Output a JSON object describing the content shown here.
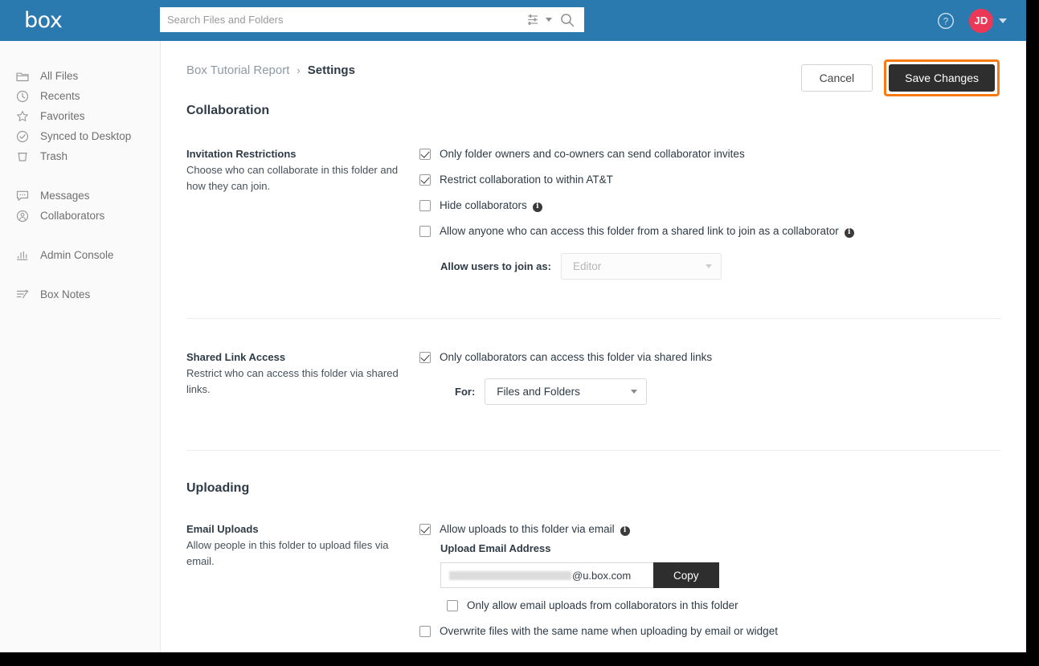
{
  "topbar": {
    "logo_text": "box",
    "search": {
      "placeholder": "Search Files and Folders",
      "value": "",
      "filter_icon": "filters-icon",
      "search_icon": "search-icon"
    },
    "help_icon": "help-circle-icon",
    "avatar_initials": "JD",
    "brand_color": "#2a7ab0",
    "avatar_color": "#ed3757"
  },
  "sidebar": {
    "items": [
      {
        "label": "All Files",
        "icon": "folder-icon"
      },
      {
        "label": "Recents",
        "icon": "clock-icon"
      },
      {
        "label": "Favorites",
        "icon": "star-icon"
      },
      {
        "label": "Synced to Desktop",
        "icon": "check-circle-icon"
      },
      {
        "label": "Trash",
        "icon": "trash-icon"
      },
      {
        "label": "Messages",
        "icon": "chat-bubble-icon"
      },
      {
        "label": "Collaborators",
        "icon": "person-circle-icon"
      },
      {
        "label": "Admin Console",
        "icon": "bar-chart-icon"
      },
      {
        "label": "Box Notes",
        "icon": "notes-pencil-icon"
      }
    ]
  },
  "breadcrumb": {
    "parent": "Box Tutorial Report",
    "separator": "›",
    "current": "Settings"
  },
  "actions": {
    "cancel_label": "Cancel",
    "save_label": "Save Changes",
    "save_highlight_color": "#f57b15"
  },
  "sections": {
    "collaboration": {
      "title": "Collaboration",
      "invitation": {
        "heading": "Invitation Restrictions",
        "description": "Choose who can collaborate in this folder and how they can join.",
        "checkboxes": [
          {
            "label": "Only folder owners and co-owners can send collaborator invites",
            "checked": true,
            "info": false
          },
          {
            "label": "Restrict collaboration to within AT&T",
            "checked": true,
            "info": false
          },
          {
            "label": "Hide collaborators",
            "checked": false,
            "info": true
          },
          {
            "label": "Allow anyone who can access this folder from a shared link to join as a collaborator",
            "checked": false,
            "info": true
          }
        ],
        "join_as": {
          "label": "Allow users to join as:",
          "value": "Editor",
          "disabled": true
        }
      },
      "shared_link": {
        "heading": "Shared Link Access",
        "description": "Restrict who can access this folder via shared links.",
        "checkboxes": [
          {
            "label": "Only collaborators can access this folder via shared links",
            "checked": true,
            "info": false
          }
        ],
        "for_select": {
          "label": "For:",
          "value": "Files and Folders",
          "disabled": false
        }
      }
    },
    "uploading": {
      "title": "Uploading",
      "email_uploads": {
        "heading": "Email Uploads",
        "description": "Allow people in this folder to upload files via email.",
        "allow_checkbox": {
          "label": "Allow uploads to this folder via email",
          "checked": true,
          "info": true
        },
        "address_label": "Upload Email Address",
        "address_domain": "@u.box.com",
        "address_redacted": true,
        "copy_label": "Copy",
        "only_collaborators_checkbox": {
          "label": "Only allow email uploads from collaborators in this folder",
          "checked": false
        },
        "overwrite_checkbox": {
          "label": "Overwrite files with the same name when uploading by email or widget",
          "checked": false
        }
      }
    }
  }
}
